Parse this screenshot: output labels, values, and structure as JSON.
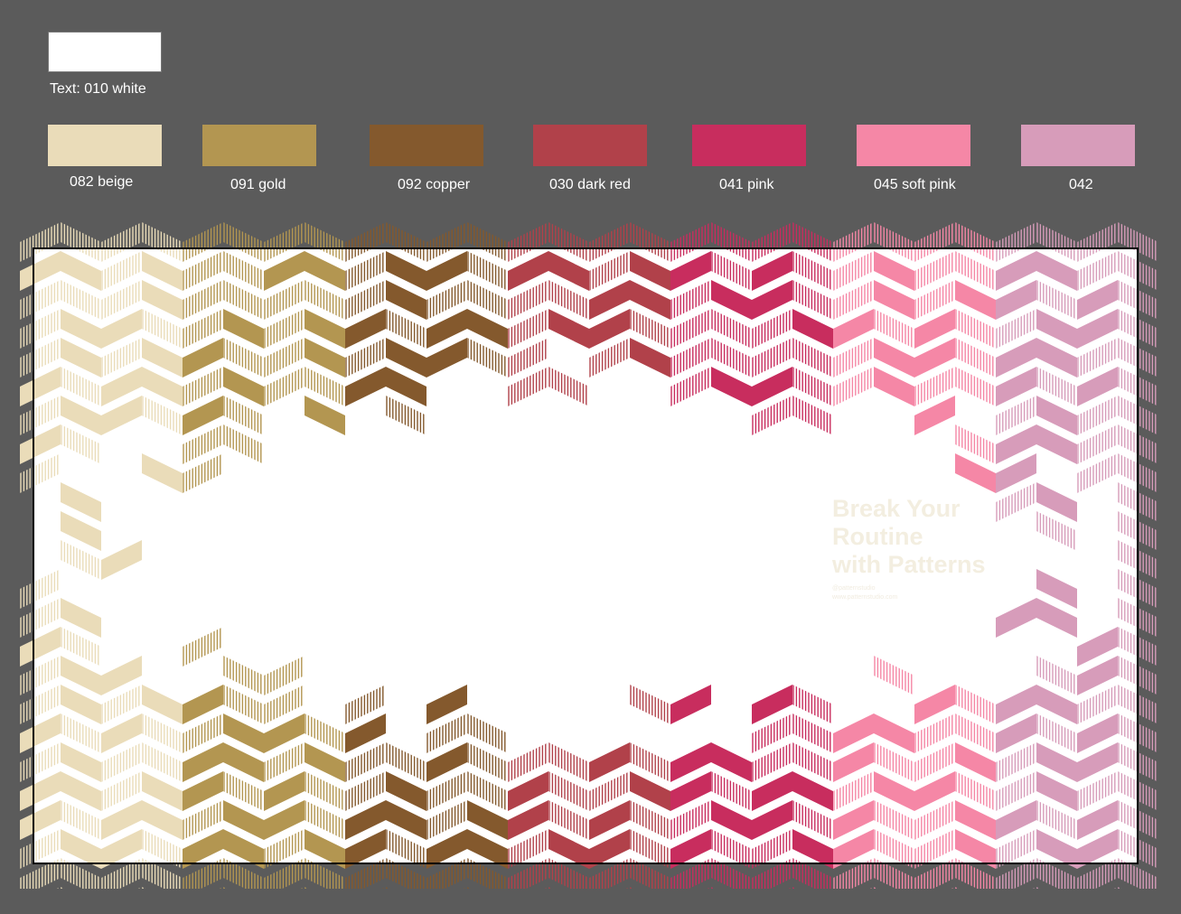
{
  "text_swatch": {
    "label": "Text: 010 white",
    "color": "#ffffff"
  },
  "swatches": [
    {
      "label": "082 beige",
      "color": "#eadcb9"
    },
    {
      "label": "091 gold",
      "color": "#b39651"
    },
    {
      "label": "092 copper",
      "color": "#84592d"
    },
    {
      "label": "030 dark red",
      "color": "#b1414a"
    },
    {
      "label": "041 pink",
      "color": "#c82d5e"
    },
    {
      "label": "045 soft pink",
      "color": "#f587a6"
    },
    {
      "label": "042",
      "color": "#d79cba"
    }
  ],
  "canvas": {
    "background": "#ffffff",
    "border_color": "#000000",
    "page_background": "#5b5b5b"
  },
  "promo": {
    "title": "Break Your\nRoutine\nwith Patterns",
    "social_line": "@patternstudio",
    "url_line": "www.patternstudio.com"
  }
}
